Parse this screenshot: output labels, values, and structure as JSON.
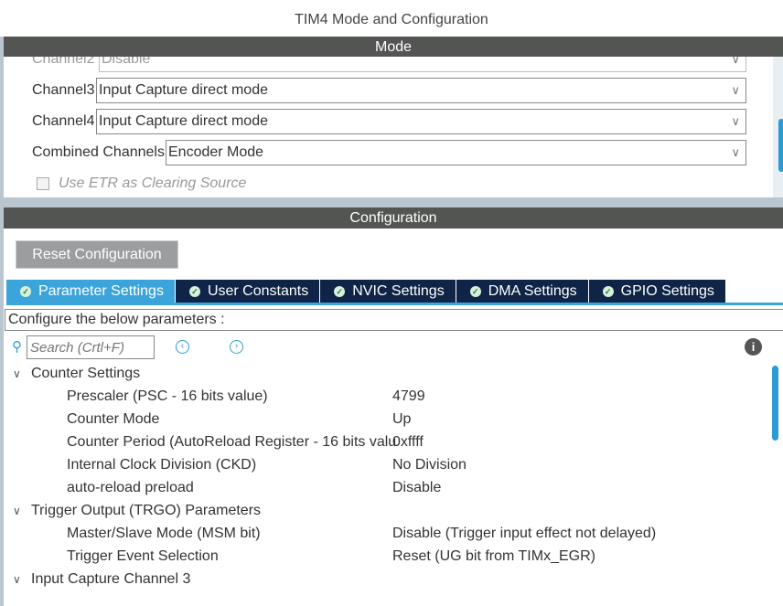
{
  "title": "TIM4 Mode and Configuration",
  "mode": {
    "header": "Mode",
    "rows": [
      {
        "label": "Channel2",
        "value": "Disable"
      },
      {
        "label": "Channel3",
        "value": "Input Capture direct mode"
      },
      {
        "label": "Channel4",
        "value": "Input Capture direct mode"
      },
      {
        "label": "Combined Channels",
        "value": "Encoder Mode"
      }
    ],
    "etr_label": "Use ETR as Clearing Source",
    "etr_checked": false
  },
  "config": {
    "header": "Configuration",
    "reset_label": "Reset Configuration",
    "tabs": [
      {
        "label": "Parameter Settings",
        "active": true
      },
      {
        "label": "User Constants"
      },
      {
        "label": "NVIC Settings"
      },
      {
        "label": "DMA Settings"
      },
      {
        "label": "GPIO Settings"
      }
    ],
    "configure_text": "Configure the below parameters :",
    "search_placeholder": "Search (Crtl+F)",
    "groups": [
      {
        "name": "Counter Settings",
        "params": [
          {
            "label": "Prescaler (PSC - 16 bits value)",
            "value": "4799"
          },
          {
            "label": "Counter Mode",
            "value": "Up"
          },
          {
            "label": "Counter Period (AutoReload Register - 16 bits valu",
            "value": "0xffff"
          },
          {
            "label": "Internal Clock Division (CKD)",
            "value": "No Division"
          },
          {
            "label": "auto-reload preload",
            "value": "Disable"
          }
        ]
      },
      {
        "name": "Trigger Output (TRGO) Parameters",
        "params": [
          {
            "label": "Master/Slave Mode (MSM bit)",
            "value": "Disable (Trigger input effect not delayed)"
          },
          {
            "label": "Trigger Event Selection",
            "value": "Reset (UG bit from TIMx_EGR)"
          }
        ]
      },
      {
        "name": "Input Capture Channel 3",
        "params": []
      }
    ]
  }
}
